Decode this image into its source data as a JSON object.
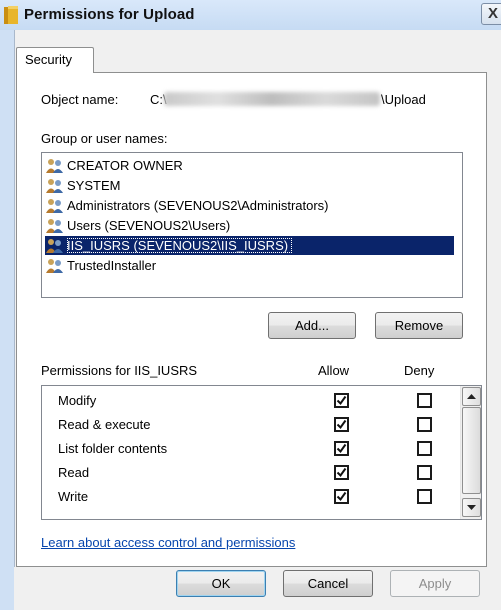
{
  "window": {
    "title": "Permissions for Upload",
    "close_glyph": "X"
  },
  "tabs": [
    {
      "label": "Security"
    }
  ],
  "object": {
    "label": "Object name:",
    "prefix": "C:\\",
    "suffix": "\\Upload"
  },
  "groups": {
    "label": "Group or user names:",
    "users": [
      {
        "name": "CREATOR OWNER"
      },
      {
        "name": "SYSTEM"
      },
      {
        "name": "Administrators (SEVENOUS2\\Administrators)"
      },
      {
        "name": "Users (SEVENOUS2\\Users)"
      },
      {
        "name": "IIS_IUSRS (SEVENOUS2\\IIS_IUSRS)",
        "selected": true
      },
      {
        "name": "TrustedInstaller"
      }
    ],
    "add_label": "Add...",
    "remove_label": "Remove"
  },
  "permissions": {
    "header": "Permissions for IIS_IUSRS",
    "allow_label": "Allow",
    "deny_label": "Deny",
    "rows": [
      {
        "name": "Modify",
        "allow": true,
        "deny": false
      },
      {
        "name": "Read & execute",
        "allow": true,
        "deny": false
      },
      {
        "name": "List folder contents",
        "allow": true,
        "deny": false
      },
      {
        "name": "Read",
        "allow": true,
        "deny": false
      },
      {
        "name": "Write",
        "allow": true,
        "deny": false
      }
    ]
  },
  "link": "Learn about access control and permissions",
  "footer": {
    "ok": "OK",
    "cancel": "Cancel",
    "apply": "Apply"
  },
  "colors": {
    "selection": "#0a246a",
    "link": "#0645ad",
    "title_bar": "#c6dbf3"
  }
}
